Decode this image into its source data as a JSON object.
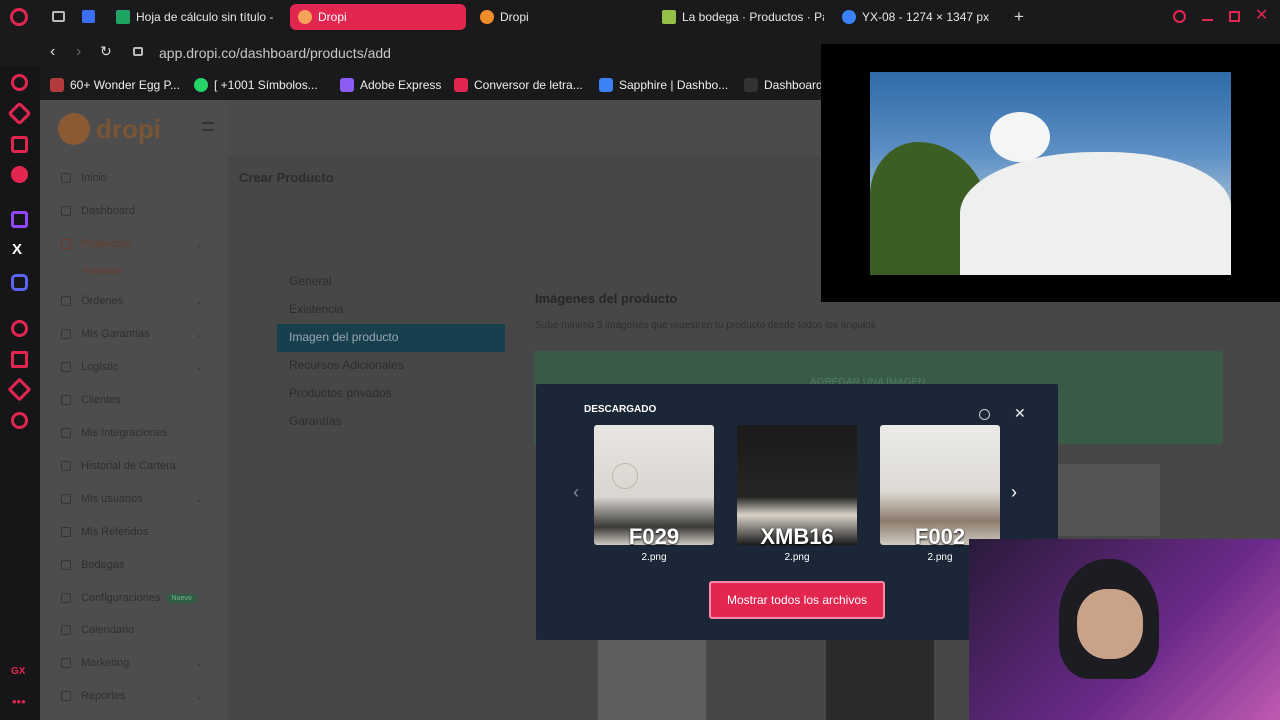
{
  "browser": {
    "tabs": [
      {
        "label": "Hoja de cálculo sin título -",
        "color": "#1fa463"
      },
      {
        "label": "Dropi",
        "color": "#f28c28",
        "active": true
      },
      {
        "label": "Dropi",
        "color": "#f28c28"
      },
      {
        "label": "La bodega · Productos · Pa",
        "color": "#95bf47"
      },
      {
        "label": "YX-08 - 1274 × 1347 px",
        "color": "#3b82f6"
      }
    ],
    "url": "app.dropi.co/dashboard/products/add",
    "bookmarks": [
      {
        "label": "60+ Wonder Egg P...",
        "color": "#b23c3c"
      },
      {
        "label": "[ +1001 Símbolos...",
        "color": "#25d366"
      },
      {
        "label": "Adobe Express",
        "color": "#8b5cf6"
      },
      {
        "label": "Conversor de letra...",
        "color": "#e3264f"
      },
      {
        "label": "Sapphire | Dashbo...",
        "color": "#3b82f6"
      },
      {
        "label": "Dashboard",
        "color": "#333333"
      }
    ]
  },
  "app": {
    "logo": "dropi",
    "page_title": "Crear Producto",
    "sidebar": [
      {
        "label": "Inicio"
      },
      {
        "label": "Dashboard"
      },
      {
        "label": "Productos",
        "active": true,
        "chev": true
      },
      {
        "label": "Productos",
        "sub": true
      },
      {
        "label": "Órdenes",
        "chev": true
      },
      {
        "label": "Mis Garantías",
        "chev": true
      },
      {
        "label": "Logistic",
        "chev": true
      },
      {
        "label": "Clientes"
      },
      {
        "label": "Mis Integraciones"
      },
      {
        "label": "Historial de Cartera"
      },
      {
        "label": "Mis usuarios",
        "chev": true
      },
      {
        "label": "Mis Referidos"
      },
      {
        "label": "Bodegas"
      },
      {
        "label": "Configuraciones",
        "badge": "Nuevo"
      },
      {
        "label": "Calendario"
      },
      {
        "label": "Marketing",
        "chev": true
      },
      {
        "label": "Reportes",
        "chev": true
      }
    ],
    "form_menu": [
      "General",
      "Existencia",
      "Imagen del producto",
      "Recursos Adicionales",
      "Productos privados",
      "Garantías"
    ],
    "section_title": "Imágenes del producto",
    "section_hint": "Sube mínimo 3 imágenes que muestren tu producto desde todos los ángulos",
    "drop_label": "AGREGAR UNA IMAGEN"
  },
  "downloads": {
    "heading": "DESCARGADO",
    "items": [
      {
        "title": "F029",
        "file": "2.png"
      },
      {
        "title": "XMB16",
        "file": "2.png"
      },
      {
        "title": "F002",
        "file": "2.png"
      }
    ],
    "show_all": "Mostrar todos los archivos"
  }
}
